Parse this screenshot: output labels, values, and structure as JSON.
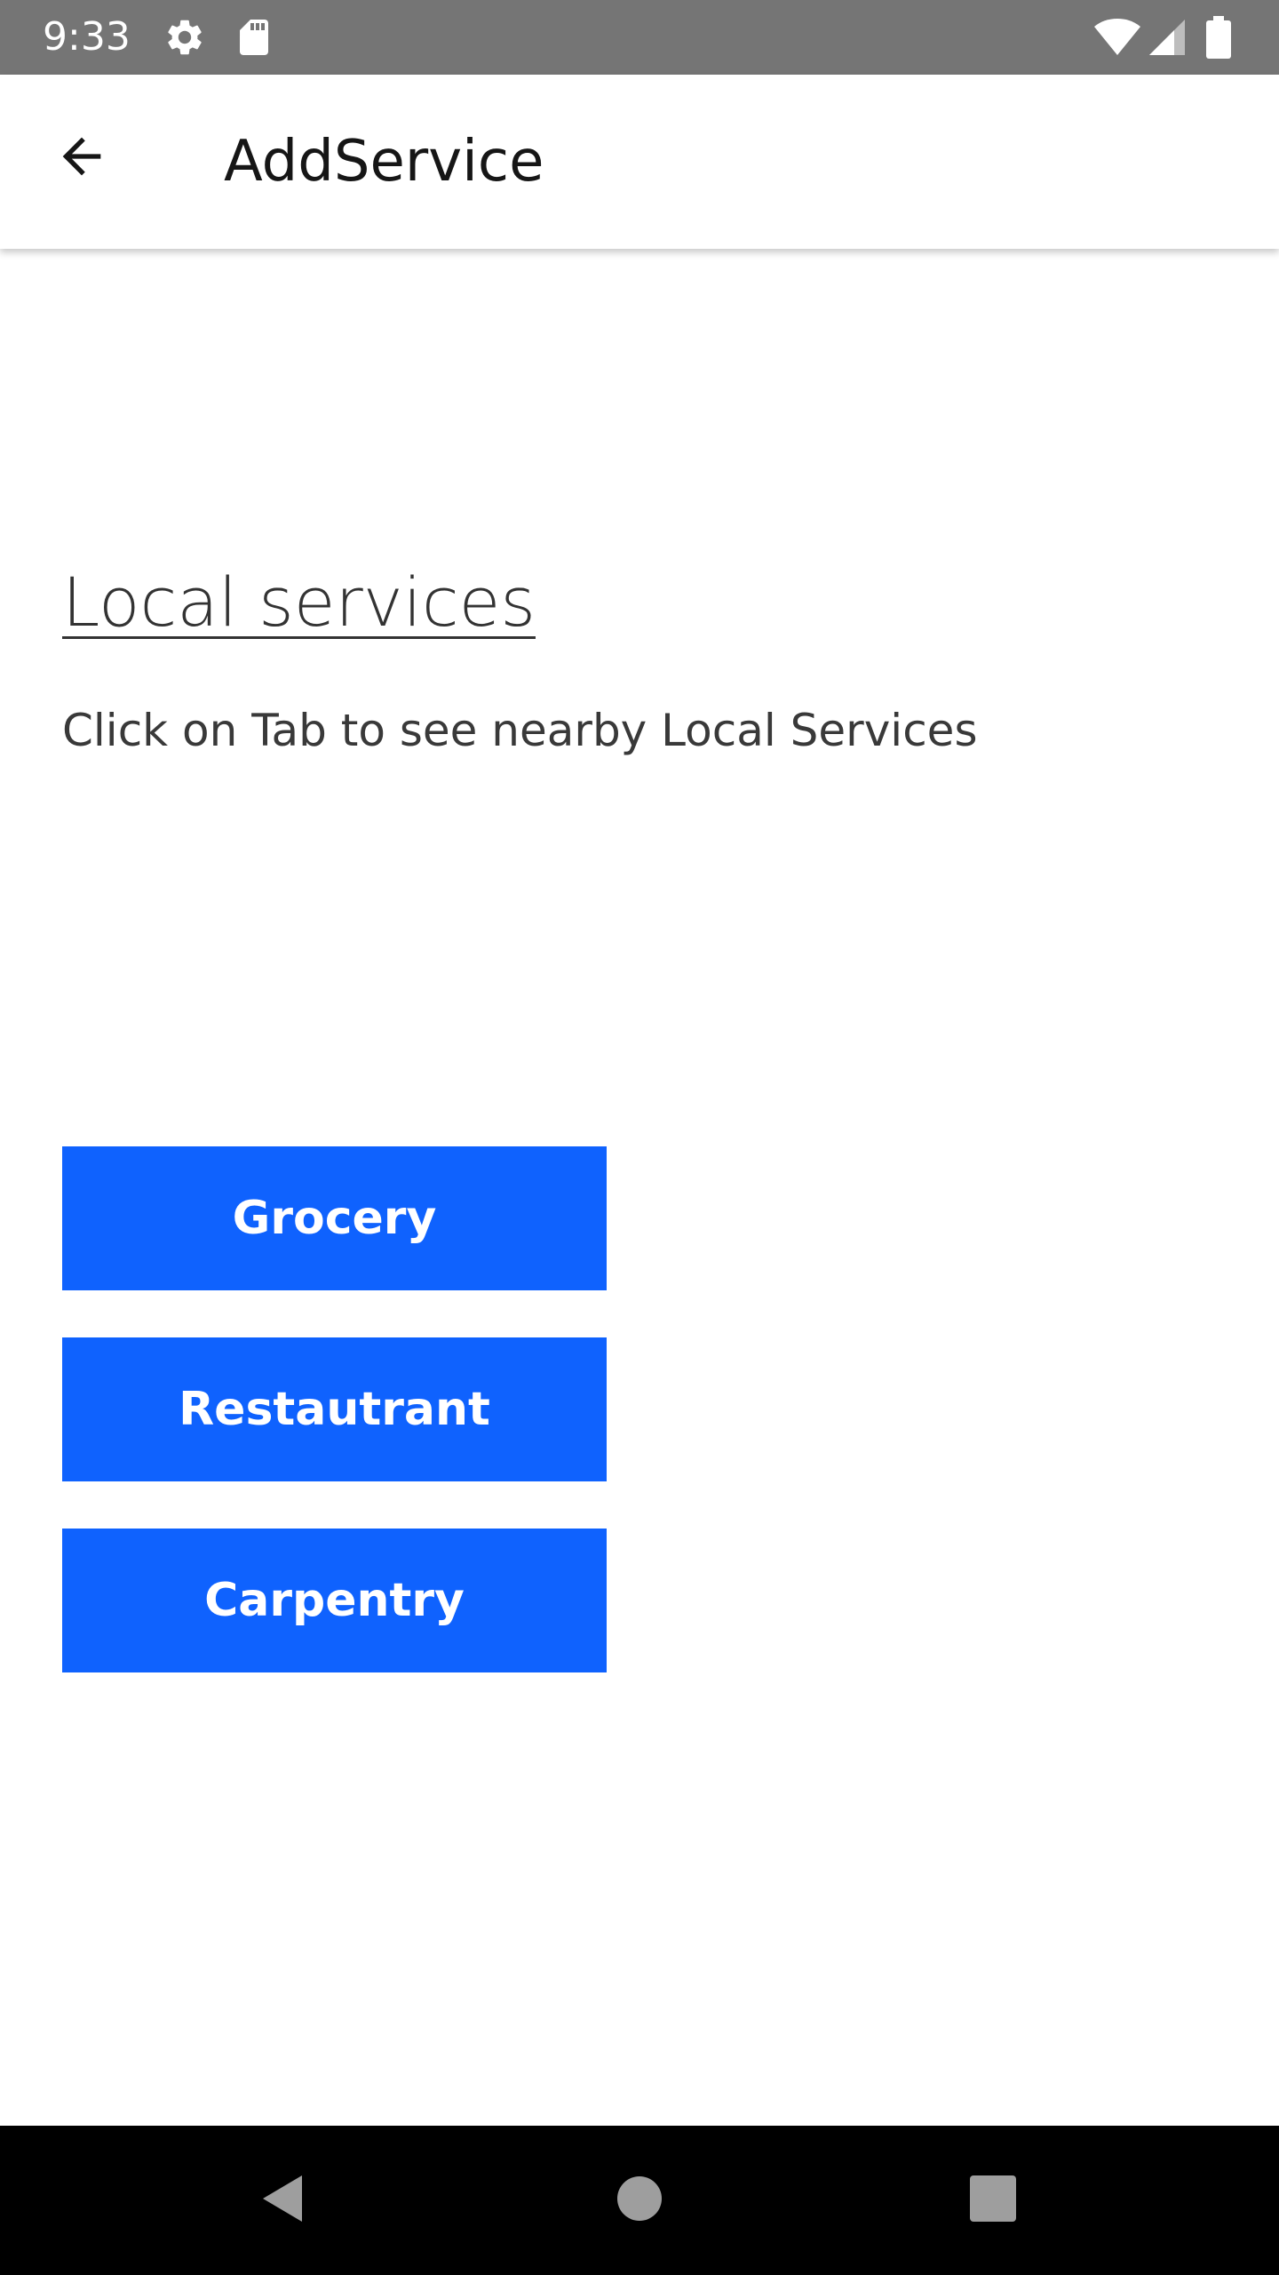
{
  "status_bar": {
    "time": "9:33",
    "icons": [
      "gear-icon",
      "sd-card-icon",
      "wifi-icon",
      "cell-signal-icon",
      "battery-icon"
    ]
  },
  "app_bar": {
    "title": "AddService",
    "back_icon": "arrow-back-icon"
  },
  "main": {
    "heading": "Local services",
    "description": "Click on Tab to see nearby Local Services",
    "buttons": [
      {
        "label": "Grocery"
      },
      {
        "label": "Restautrant"
      },
      {
        "label": "Carpentry"
      }
    ]
  },
  "nav_bar": {
    "icons": [
      "nav-back-icon",
      "nav-home-icon",
      "nav-recents-icon"
    ]
  },
  "colors": {
    "status_bar": "#757575",
    "accent": "#0f62fe",
    "nav_bar": "#000000"
  }
}
